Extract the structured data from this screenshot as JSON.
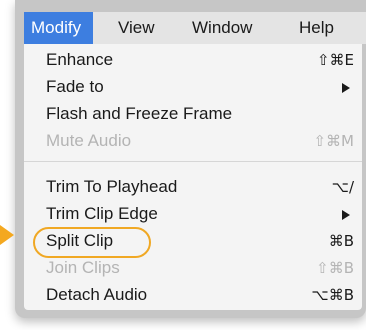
{
  "menubar": {
    "titles": [
      "Modify",
      "View",
      "Window",
      "Help"
    ]
  },
  "menu": {
    "items": [
      {
        "label": "Enhance",
        "shortcut": "⇧⌘E"
      },
      {
        "label": "Fade to",
        "submenu": true
      },
      {
        "label": "Flash and Freeze Frame"
      },
      {
        "label": "Mute Audio",
        "shortcut": "⇧⌘M",
        "disabled": true
      },
      {
        "label": "Trim To Playhead",
        "shortcut": "⌥/"
      },
      {
        "label": "Trim Clip Edge",
        "submenu": true
      },
      {
        "label": "Split Clip",
        "shortcut": "⌘B",
        "circled": true
      },
      {
        "label": "Join Clips",
        "shortcut": "⇧⌘B",
        "disabled": true
      },
      {
        "label": "Detach Audio",
        "shortcut": "⌥⌘B"
      }
    ]
  },
  "colors": {
    "selection": "#3d7ee0",
    "callout": "#f0a824"
  },
  "icons": {
    "submenu": "chevron-right-icon",
    "pointer": "arrow-pointer-icon"
  }
}
